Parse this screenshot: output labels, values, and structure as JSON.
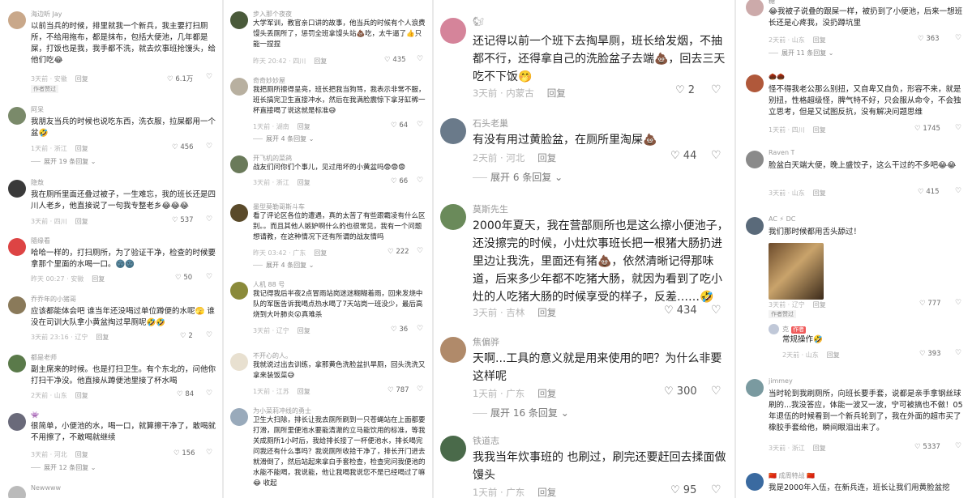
{
  "col1": [
    {
      "name": "海边听 Jay",
      "text": "以前当兵的时候，排里就我一个新兵，我主要打扫厕所，不给用拖布，都是抹布，包括大便池，几年都是屎，打饭也是我，我手都不洗，就去炊事班抢馒头，给他们吃😂",
      "time": "3天前 · 安徽",
      "reply": "回复",
      "likes": "6.1万",
      "badge": "作者赞过"
    },
    {
      "name": "阿呆",
      "text": "我朋友当兵的时候也说吃东西，洗衣服，拉屎都用一个盆🤣",
      "time": "1天前 · 浙江",
      "reply": "回复",
      "likes": "456",
      "expand": "展开 19 条回复"
    },
    {
      "name": "隐敖",
      "text": "我在厕所里面还叠过被子，一生难忘，我的班长还是四川人老乡，他直接说了一句我专整老乡😂😂😂",
      "time": "3天前 · 四川",
      "reply": "回复",
      "likes": "537"
    },
    {
      "name": "隨缘看",
      "text": "哈哈一样的，打扫厕所，为了验证干净，检查的时候要拿那个里面的水喝一口。🌚🌚",
      "time": "昨天 00:27 · 安徽",
      "reply": "回复",
      "likes": "50"
    },
    {
      "name": "乔乔年的小猪哥",
      "text": "应该都能体会吧 谁当年还没喝过单位蹲便的水呢🫣 谁没在司训大队拿小黄盆掏过旱厕呢🤣🤣",
      "time": "3天前 23:16 · 辽宁",
      "reply": "回复",
      "likes": "2"
    },
    {
      "name": "都是老师",
      "text": "副主席来的时候。也是打扫卫生。有个东北的，问他你打扫干净没。他直接从蹲便池里接了杯水喝",
      "time": "2天前 · 山东",
      "reply": "回复",
      "likes": "84"
    },
    {
      "name": "👾",
      "text": "很简单，小便池的水，喝一口，就算擦干净了，敢喝就不用擦了，不敢喝就继续",
      "time": "3天前 · 河北",
      "reply": "回复",
      "likes": "156",
      "expand": "展开 12 条回复"
    },
    {
      "name": "Newwww",
      "text": "",
      "time": "",
      "reply": "",
      "likes": ""
    }
  ],
  "col2": [
    {
      "name": "步入那个夜夜",
      "text": "大学军训，教官亲口讲的故事，他当兵的时候有个人浪费馒头丢厕所了，惩罚全班拿馒头站💩吃，太牛逼了👍只能一捏捏",
      "time": "昨天 20:42 · 四川",
      "reply": "回复",
      "likes": "435"
    },
    {
      "name": "奇奇妙妙屋",
      "text": "我把厕所擦得呈亮，班长把我当狗骂，我表示非常不服，班长搞完卫生直接冲水，然后在我满脸震惊下拿牙缸稀一杯直接喝了说这就是标准😅",
      "time": "1天前 · 湖南",
      "reply": "回复",
      "likes": "64",
      "expand": "展开 4 条回复"
    },
    {
      "name": "开飞机的菜鸽",
      "text": "战友们问你们个事儿，见过用坏的小黄盆吗😨😨😨",
      "time": "3天前 · 浙江",
      "reply": "回复",
      "likes": "66"
    },
    {
      "name": "墨型莫勒哥斯斗车",
      "text": "看了评论区各位的遭遇，真的太苦了有些跟霸凌有什么区别。。而且其他人嫉妒啊什么的也很常见，我有一个问题想请教，在这种情况下还有所谓的战友情吗",
      "time": "昨天 03:42 · 广东",
      "reply": "回复",
      "likes": "222",
      "expand": "展开 4 条回复"
    },
    {
      "name": "人机 88 号",
      "text": "我记得我后半夜2点冒雨站岗迷迷糊糊着雨，回来发烧中队的军医告诉我喝点热水喝了7天站岗一班没少，最后高烧到大叶肺炎😮真难杀",
      "time": "3天前 · 辽宁",
      "reply": "回复",
      "likes": "36"
    },
    {
      "name": "不开心的人。",
      "text": "我就说过出去训练，拿那黄色洗脸盆扒旱厕，回头洗洗又拿来装饭菜😅",
      "time": "1天前 · 江苏",
      "reply": "回复",
      "likes": "787"
    },
    {
      "name": "为小菜莉冲线的勇士",
      "text": "卫生大扫除，排长让我去厕所刷到一只苍蝇站在上面都要打滑，厕所里便池水要能清澈的立马能饮用的标准，等我关成厕所1小时后，我给排长接了一杯便池水，排长喝完问我还有什么事吗？我说厕所收拾干净了，排长开门进去就滑倒了，然后站起来拿白手套检查，检查完问我便池的水能不能喝，我说能，他让我喝我说您不是已经喝过了嘛😂 收起",
      "time": "",
      "reply": "",
      "likes": ""
    }
  ],
  "col3": [
    {
      "name": "🐿",
      "text": "还记得以前一个班下去掏旱厕，班长给发烟，不抽都不行，还得拿自己的洗脸盆子去端💩，回去三天吃不下饭🤭",
      "time": "3天前 · 内蒙古",
      "reply": "回复",
      "likes": "2"
    },
    {
      "name": "石头老巢",
      "text": "有没有用过黄脸盆，在厕所里淘屎💩",
      "time": "2天前 · 河北",
      "reply": "回复",
      "likes": "44",
      "expand": "展开 6 条回复"
    },
    {
      "name": "莫斯先生",
      "text": "2000年夏天，我在营部厕所也是这么擦小便池子，还没擦完的时候，小灶炊事班长把一根猪大肠扔进里边让我洗，里面还有猪💩，依然清晰记得那味道，后来多少年都不吃猪大肠，就因为看到了吃小灶的人吃猪大肠的时候享受的样子，反差……🤣",
      "time": "3天前 · 吉林",
      "reply": "回复",
      "likes": "434"
    },
    {
      "name": "焦偏骅",
      "text": "天啊...工具的意义就是用来使用的吧？为什么非要这样呢",
      "time": "1天前 · 广东",
      "reply": "回复",
      "likes": "300",
      "expand": "展开 16 条回复"
    },
    {
      "name": "铁道志",
      "text": "我我当年炊事班的 也刷过，刷完还要赶回去揉面做馒头",
      "time": "1天前 · 广东",
      "reply": "回复",
      "likes": "95"
    }
  ],
  "col4": [
    {
      "name": "糖",
      "text": "😂我被子说叠的跟屎一样，被扔到了小便池，后来一想班长还是心疼我，没扔蹲坑里",
      "time": "2天前 · 山东",
      "reply": "回复",
      "likes": "363",
      "expand": "展开 11 条回复"
    },
    {
      "name": "🌰🌰",
      "text": "怪不得我老公那么别扭，又自卑又自负，形容不来，就是别扭，性格超级怪，脾气特不好，只会服从命令，不会独立思考，但是又试图反抗，没有解决问题思维",
      "time": "1天前 · 四川",
      "reply": "回复",
      "likes": "1745"
    },
    {
      "name": "Raven T",
      "text": "脸盆白天端大便，晚上盛饺子，这么干过的不多吧😂😂",
      "time": "3天前 · 山东",
      "reply": "回复",
      "likes": "415"
    },
    {
      "name": "AC ⚡ DC",
      "text": "我们那时候都用舌头舔过！",
      "time": "3天前 · 辽宁",
      "reply": "回复",
      "likes": "777",
      "badge": "作者赞过",
      "sub": {
        "name": "克",
        "tag": "作者",
        "text": "常规操作🤣",
        "time": "2天前 · 山东",
        "reply": "回复",
        "likes": "393"
      }
    },
    {
      "name": "jimmey",
      "text": "当时轮到我刷厕所，向班长要手套，说都是亲手拿钢丝球刷的...我没答应，体能一波又一波，宁可被搞也不做！05年退伍的时候看到一个新兵轮到了，我在外面的超市买了橡胶手套给他，瞬间眼泪出来了。",
      "time": "3天前 · 浙江",
      "reply": "回复",
      "likes": "5337"
    },
    {
      "name": "🇨🇳 成周特战 🇨🇳",
      "text": "我是2000年入伍，在新兵连，班长让我们用黄脸盆挖",
      "time": "",
      "reply": "",
      "likes": ""
    }
  ]
}
